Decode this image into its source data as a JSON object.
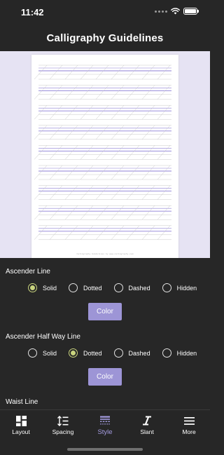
{
  "status_bar": {
    "time": "11:42"
  },
  "header": {
    "title": "Calligraphy Guidelines"
  },
  "preview": {
    "footer_text": "Calligraphy Guidelines by www.calligraphy.com"
  },
  "sections": [
    {
      "label": "Ascender Line",
      "options": [
        "Solid",
        "Dotted",
        "Dashed",
        "Hidden"
      ],
      "selected": "Solid",
      "color_button": "Color"
    },
    {
      "label": "Ascender Half Way Line",
      "options": [
        "Solid",
        "Dotted",
        "Dashed",
        "Hidden"
      ],
      "selected": "Dotted",
      "color_button": "Color"
    },
    {
      "label": "Waist Line"
    }
  ],
  "tabs": [
    {
      "label": "Layout",
      "icon": "layout-icon",
      "active": false
    },
    {
      "label": "Spacing",
      "icon": "spacing-icon",
      "active": false
    },
    {
      "label": "Style",
      "icon": "style-icon",
      "active": true
    },
    {
      "label": "Slant",
      "icon": "slant-icon",
      "active": false
    },
    {
      "label": "More",
      "icon": "more-icon",
      "active": false
    }
  ],
  "colors": {
    "accent": "#a49ce0",
    "button": "#9d95d6",
    "radio_selected": "#c9d47e",
    "preview_background": "#e6e3f3",
    "guideline_purple": "#8c7fd6"
  }
}
